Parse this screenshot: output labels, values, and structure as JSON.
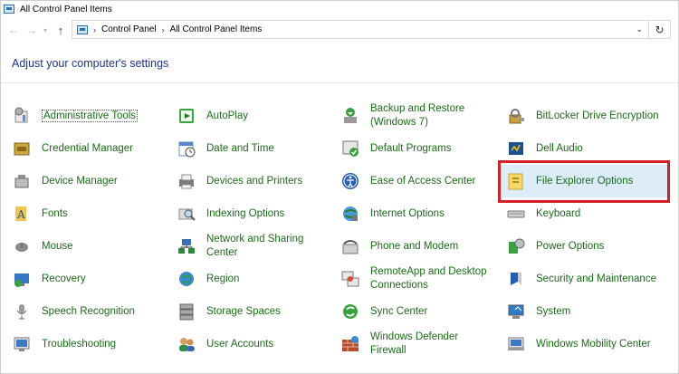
{
  "window": {
    "title": "All Control Panel Items"
  },
  "nav": {
    "back_icon": "arrow-left-icon",
    "forward_icon": "arrow-right-icon",
    "recent_icon": "chevron-down-icon",
    "up_icon": "arrow-up-icon",
    "breadcrumbs": [
      "Control Panel",
      "All Control Panel Items"
    ],
    "refresh_icon": "refresh-icon"
  },
  "heading": "Adjust your computer's settings",
  "colors": {
    "link": "#1a6b16",
    "heading": "#1e3287",
    "highlight": "#dcecf9",
    "annotation": "#d62027"
  },
  "items": [
    {
      "label": "Administrative Tools",
      "icon": "administrative-tools-icon"
    },
    {
      "label": "AutoPlay",
      "icon": "autoplay-icon"
    },
    {
      "label": "Backup and Restore\n(Windows 7)",
      "icon": "backup-restore-icon"
    },
    {
      "label": "BitLocker Drive Encryption",
      "icon": "bitlocker-icon"
    },
    {
      "label": "Credential Manager",
      "icon": "credential-manager-icon"
    },
    {
      "label": "Date and Time",
      "icon": "date-time-icon"
    },
    {
      "label": "Default Programs",
      "icon": "default-programs-icon"
    },
    {
      "label": "Dell Audio",
      "icon": "dell-audio-icon"
    },
    {
      "label": "Device Manager",
      "icon": "device-manager-icon"
    },
    {
      "label": "Devices and Printers",
      "icon": "devices-printers-icon"
    },
    {
      "label": "Ease of Access Center",
      "icon": "ease-of-access-icon"
    },
    {
      "label": "File Explorer Options",
      "icon": "file-explorer-options-icon"
    },
    {
      "label": "Fonts",
      "icon": "fonts-icon"
    },
    {
      "label": "Indexing Options",
      "icon": "indexing-options-icon"
    },
    {
      "label": "Internet Options",
      "icon": "internet-options-icon"
    },
    {
      "label": "Keyboard",
      "icon": "keyboard-icon"
    },
    {
      "label": "Mouse",
      "icon": "mouse-icon"
    },
    {
      "label": "Network and Sharing\nCenter",
      "icon": "network-sharing-icon"
    },
    {
      "label": "Phone and Modem",
      "icon": "phone-modem-icon"
    },
    {
      "label": "Power Options",
      "icon": "power-options-icon"
    },
    {
      "label": "Recovery",
      "icon": "recovery-icon"
    },
    {
      "label": "Region",
      "icon": "region-icon"
    },
    {
      "label": "RemoteApp and Desktop\nConnections",
      "icon": "remoteapp-icon"
    },
    {
      "label": "Security and Maintenance",
      "icon": "security-maintenance-icon"
    },
    {
      "label": "Speech Recognition",
      "icon": "speech-recognition-icon"
    },
    {
      "label": "Storage Spaces",
      "icon": "storage-spaces-icon"
    },
    {
      "label": "Sync Center",
      "icon": "sync-center-icon"
    },
    {
      "label": "System",
      "icon": "system-icon"
    },
    {
      "label": "Troubleshooting",
      "icon": "troubleshooting-icon"
    },
    {
      "label": "User Accounts",
      "icon": "user-accounts-icon"
    },
    {
      "label": "Windows Defender\nFirewall",
      "icon": "windows-firewall-icon"
    },
    {
      "label": "Windows Mobility Center",
      "icon": "windows-mobility-icon"
    }
  ]
}
